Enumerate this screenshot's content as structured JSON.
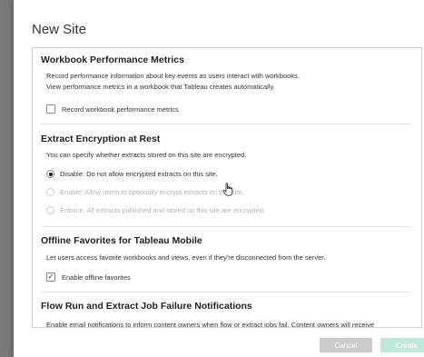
{
  "dialog": {
    "title": "New Site",
    "sections": {
      "workbook_perf": {
        "heading": "Workbook Performance Metrics",
        "desc_line1": "Record performance information about key events as users interact with workbooks.",
        "desc_line2": "View performance metrics in a workbook that Tableau creates automatically.",
        "checkbox_label": "Record workbook performance metrics",
        "checked": false
      },
      "extract_encryption": {
        "heading": "Extract Encryption at Rest",
        "desc": "You can specify whether extracts stored on this site are encrypted.",
        "options": [
          {
            "label": "Disable: Do not allow encrypted extracts on this site.",
            "selected": true,
            "enabled": true
          },
          {
            "label": "Enable: Allow users to optionally encrypt extracts on this site.",
            "selected": false,
            "enabled": false
          },
          {
            "label": "Enforce: All extracts published and stored on this site are encrypted.",
            "selected": false,
            "enabled": false
          }
        ]
      },
      "offline_favorites": {
        "heading": "Offline Favorites for Tableau Mobile",
        "desc": "Let users access favorite workbooks and views, even if they're disconnected from the server.",
        "checkbox_label": "Enable offline favorites",
        "checked": true,
        "check_glyph": "✓"
      },
      "flow_failure": {
        "heading": "Flow Run and Extract Job Failure Notifications",
        "desc": "Enable email notifications to inform content owners when flow or extract jobs fail. Content owners will receive"
      }
    },
    "buttons": {
      "cancel": "Cancel",
      "create": "Create"
    }
  },
  "icons": {
    "cursor": "hand-pointer-icon"
  }
}
